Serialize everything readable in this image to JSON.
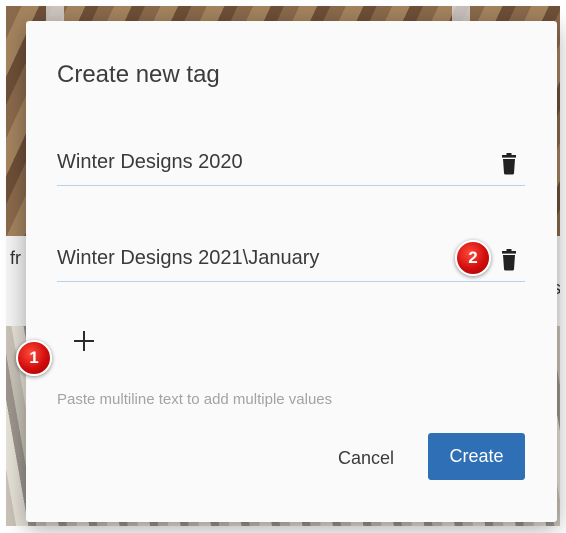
{
  "dialog": {
    "title": "Create new tag",
    "values": [
      {
        "text": "Winter Designs 2020",
        "delete_icon": "trash-icon"
      },
      {
        "text": "Winter Designs 2021\\January",
        "delete_icon": "trash-icon"
      }
    ],
    "add_icon": "plus-icon",
    "hint": "Paste multiline text to add multiple values",
    "cancel_label": "Cancel",
    "create_label": "Create"
  },
  "background": {
    "left_fragment": "fr",
    "right_fragment": "s"
  },
  "annotations": [
    {
      "label": "1"
    },
    {
      "label": "2"
    }
  ],
  "colors": {
    "primary": "#2e6fb5",
    "badge": "#d10d0d",
    "underline": "#b7d3ea"
  }
}
